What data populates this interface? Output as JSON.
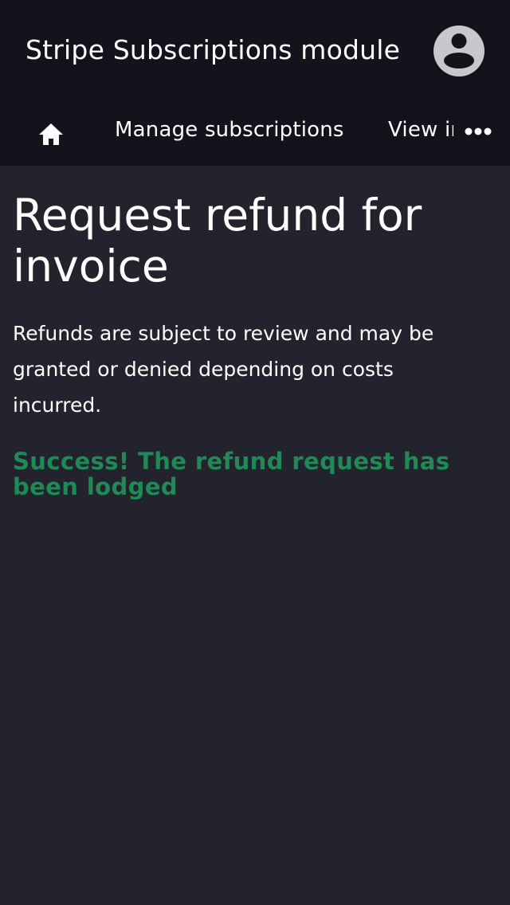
{
  "header": {
    "app_title": "Stripe Subscriptions module",
    "avatar_icon": "user-account-icon"
  },
  "nav": {
    "home_icon": "home-icon",
    "items": [
      {
        "label": "Manage subscriptions"
      },
      {
        "label": "View invoices"
      }
    ],
    "more_icon": "more-horizontal-icon"
  },
  "main": {
    "title": "Request refund for invoice",
    "description": "Refunds are subject to review and may be granted or denied depending on costs incurred.",
    "success_message": "Success! The refund request has been lodged"
  },
  "colors": {
    "header_bg": "#12131b",
    "page_bg": "#22232c",
    "success": "#1f8a56",
    "avatar": "#c8c8cc"
  }
}
